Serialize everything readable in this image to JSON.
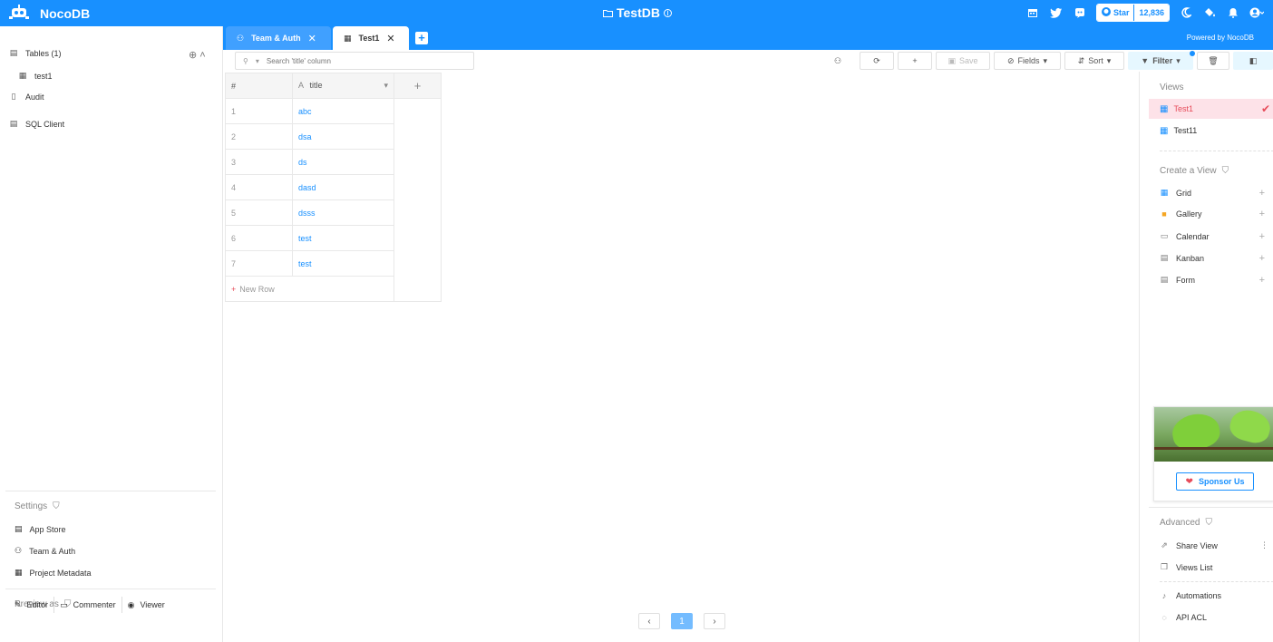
{
  "app": {
    "name": "NocoDB",
    "project_title": "TestDB"
  },
  "topbar": {
    "star_label": "Star",
    "star_count": "12,836"
  },
  "tabs": [
    {
      "label": "Team & Auth"
    },
    {
      "label": "Test1"
    }
  ],
  "powered_by": "Powered by NocoDB",
  "sidebar": {
    "tables_label": "Tables (1)",
    "table_items": [
      "test1"
    ],
    "audit_label": "Audit",
    "sql_label": "SQL Client",
    "settings_label": "Settings",
    "settings_items": [
      "App Store",
      "Team & Auth",
      "Project Metadata"
    ],
    "preview_label": "Preview as",
    "preview_roles": [
      "Editor",
      "Commenter",
      "Viewer"
    ]
  },
  "toolbar": {
    "search_placeholder": "Search 'title' column",
    "save_label": "Save",
    "fields_label": "Fields",
    "sort_label": "Sort",
    "filter_label": "Filter"
  },
  "grid": {
    "col_index_header": "#",
    "col_title_header": "title",
    "rows": [
      {
        "n": "1",
        "title": "abc"
      },
      {
        "n": "2",
        "title": "dsa"
      },
      {
        "n": "3",
        "title": "ds"
      },
      {
        "n": "4",
        "title": "dasd"
      },
      {
        "n": "5",
        "title": "dsss"
      },
      {
        "n": "6",
        "title": "test"
      },
      {
        "n": "7",
        "title": "test"
      }
    ],
    "new_row_label": "New Row"
  },
  "pagination": {
    "current": "1"
  },
  "right_panel": {
    "views_label": "Views",
    "views": [
      "Test1",
      "Test11"
    ],
    "create_label": "Create a View",
    "create_items": [
      "Grid",
      "Gallery",
      "Calendar",
      "Kanban",
      "Form"
    ],
    "sponsor_label": "Sponsor Us",
    "advanced_label": "Advanced",
    "advanced_items": [
      "Share View",
      "Views List"
    ],
    "extra_items": [
      "Automations",
      "API ACL"
    ]
  },
  "colors": {
    "primary": "#1890ff",
    "active_view_bg": "#fde2e8",
    "accent_red": "#e74c5a"
  }
}
